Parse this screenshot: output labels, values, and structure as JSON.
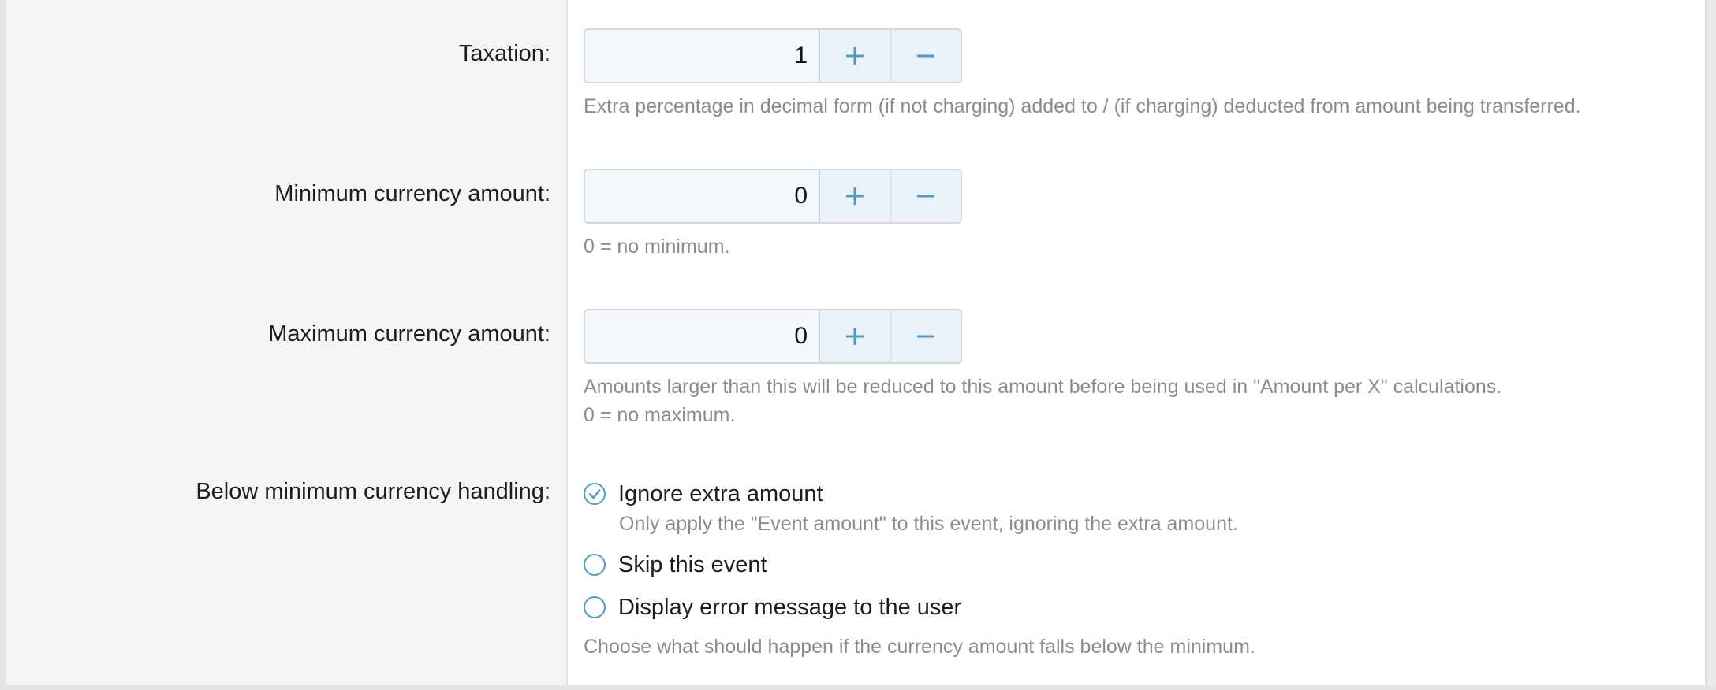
{
  "fields": {
    "taxation": {
      "label": "Taxation:",
      "value": "1",
      "increment_icon": "plus-icon",
      "decrement_icon": "minus-icon",
      "hint": "Extra percentage in decimal form (if not charging) added to / (if charging) deducted from amount being transferred."
    },
    "minimum": {
      "label": "Minimum currency amount:",
      "value": "0",
      "increment_icon": "plus-icon",
      "decrement_icon": "minus-icon",
      "hint": "0 = no minimum."
    },
    "maximum": {
      "label": "Maximum currency amount:",
      "value": "0",
      "increment_icon": "plus-icon",
      "decrement_icon": "minus-icon",
      "hint_line1": "Amounts larger than this will be reduced to this amount before being used in \"Amount per X\" calculations.",
      "hint_line2": "0 = no maximum."
    },
    "below_minimum": {
      "label": "Below minimum currency handling:",
      "options": [
        {
          "label": "Ignore extra amount",
          "description": "Only apply the \"Event amount\" to this event, ignoring the extra amount.",
          "selected": true
        },
        {
          "label": "Skip this event",
          "selected": false
        },
        {
          "label": "Display error message to the user",
          "selected": false
        }
      ],
      "hint": "Choose what should happen if the currency amount falls below the minimum."
    }
  },
  "colors": {
    "accent": "#4f9bc9",
    "label_column_bg": "#f5f5f5",
    "hint_text": "#8c8c8c",
    "input_bg": "#f4f8fc",
    "button_bg": "#eaf2fa"
  }
}
